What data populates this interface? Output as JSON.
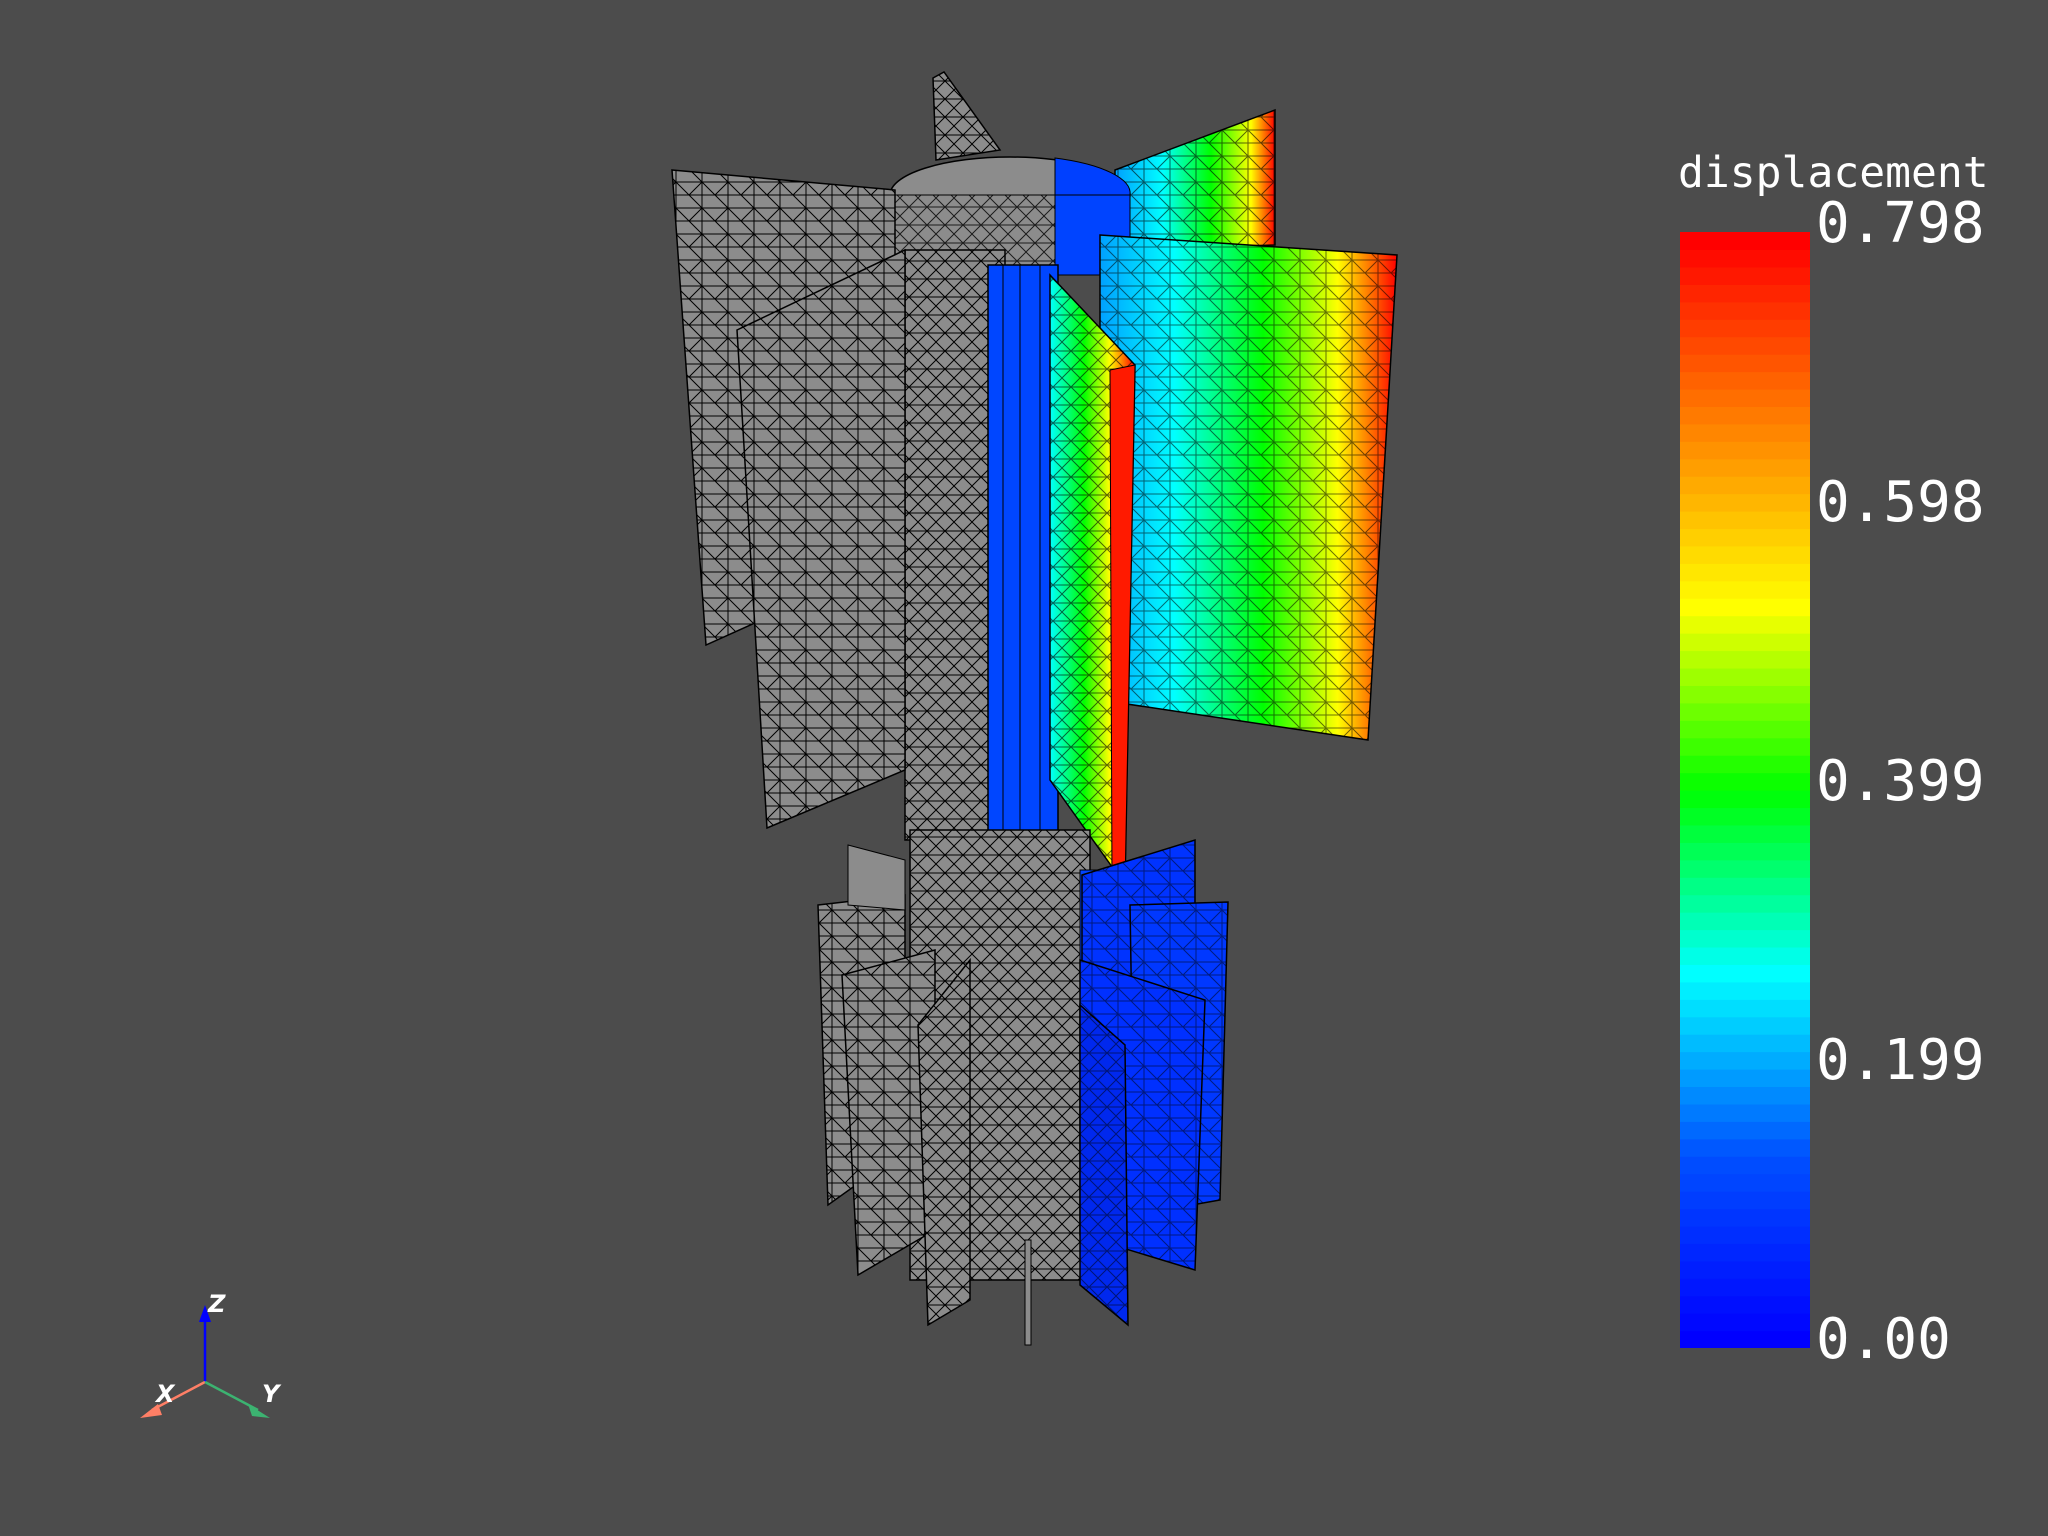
{
  "scalar_bar": {
    "title": "displacement",
    "ticks": [
      "0.798",
      "0.598",
      "0.399",
      "0.199",
      "0.00"
    ],
    "range": [
      0.0,
      0.798
    ],
    "colormap": "jet",
    "color_stops": [
      "#0000ff",
      "#0050ff",
      "#00ffff",
      "#00ff00",
      "#ffff00",
      "#ff8000",
      "#ff0000"
    ]
  },
  "axes": {
    "x_label": "X",
    "y_label": "Y",
    "z_label": "Z",
    "x_color": "#ff7f66",
    "y_color": "#3cb371",
    "z_color": "#0000ff"
  },
  "scene": {
    "background": "#4c4c4c",
    "mesh_color": "#8c8c8c",
    "edge_color": "#000000",
    "object": "finned mesh model with displacement contour",
    "max_displacement": 0.798
  }
}
